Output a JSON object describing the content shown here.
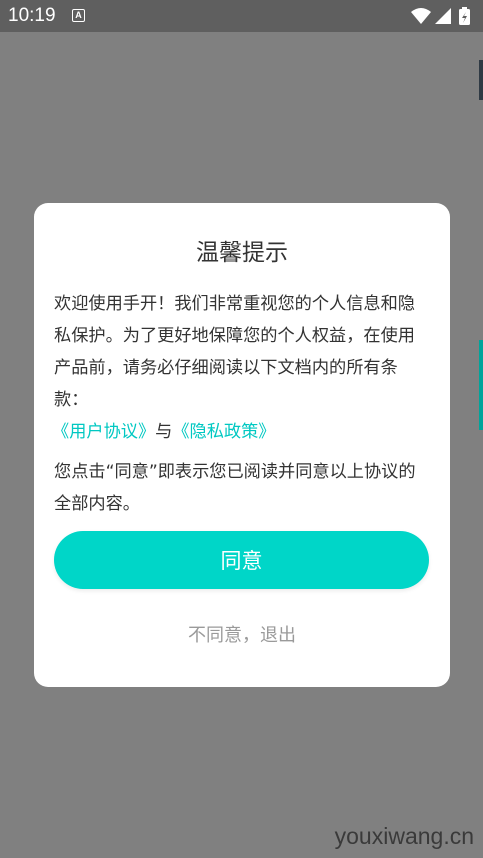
{
  "status_bar": {
    "time": "10:19",
    "app_icon_letter": "A",
    "icons": [
      "wifi-icon",
      "cell-signal-icon",
      "battery-charging-icon"
    ]
  },
  "dialog": {
    "title": "温馨提示",
    "intro": "欢迎使用手开！我们非常重视您的个人信息和隐私保护。为了更好地保障您的个人权益，在使用产品前，请务必仔细阅读以下文档内的所有条款：",
    "user_agreement_link": "《用户协议》",
    "conjunction": "与",
    "privacy_policy_link": "《隐私政策》",
    "consent_note": "您点击“同意”即表示您已阅读并同意以上协议的全部内容。",
    "agree_label": "同意",
    "decline_label": "不同意，退出"
  },
  "watermark": "youxiwang.cn",
  "colors": {
    "accent": "#00d6c8",
    "link": "#00c8c2",
    "overlay": "#808080"
  }
}
